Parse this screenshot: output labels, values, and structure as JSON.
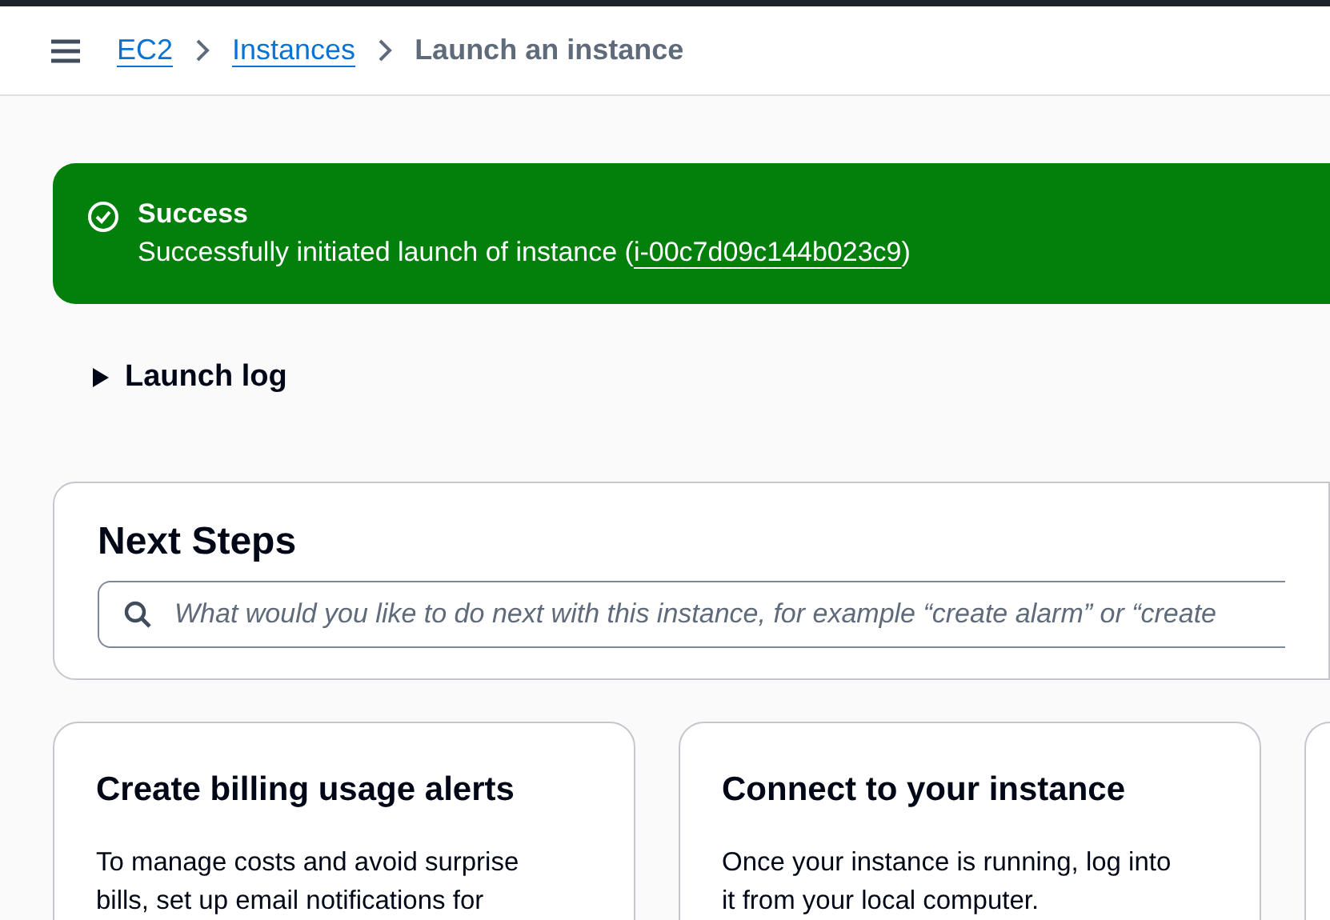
{
  "breadcrumbs": [
    {
      "label": "EC2",
      "kind": "link"
    },
    {
      "label": "Instances",
      "kind": "link"
    },
    {
      "label": "Launch an instance",
      "kind": "current"
    }
  ],
  "flash": {
    "title": "Success",
    "message_prefix": "Successfully initiated launch of instance (",
    "instance_id": "i-00c7d09c144b023c9",
    "message_suffix": ")"
  },
  "launch_log": {
    "label": "Launch log",
    "expanded": false
  },
  "next_steps": {
    "title": "Next Steps",
    "search": {
      "placeholder": "What would you like to do next with this instance, for example “create alarm” or “create"
    }
  },
  "cards": [
    {
      "title": "Create billing usage alerts",
      "body": "To manage costs and avoid surprise bills, set up email notifications for"
    },
    {
      "title": "Connect to your instance",
      "body": "Once your instance is running, log into it from your local computer."
    }
  ]
}
